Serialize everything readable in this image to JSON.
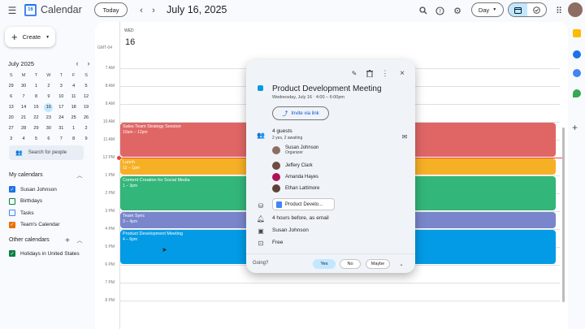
{
  "header": {
    "app_title": "Calendar",
    "logo_day": "16",
    "today_label": "Today",
    "date_title": "July 16, 2025",
    "view_label": "Day"
  },
  "sidebar": {
    "create_label": "Create",
    "mini_cal": {
      "title": "July 2025",
      "weekdays": [
        "S",
        "M",
        "T",
        "W",
        "T",
        "F",
        "S"
      ],
      "weeks": [
        [
          "29",
          "30",
          "1",
          "2",
          "3",
          "4",
          "5"
        ],
        [
          "6",
          "7",
          "8",
          "9",
          "10",
          "11",
          "12"
        ],
        [
          "13",
          "14",
          "15",
          "16",
          "17",
          "18",
          "19"
        ],
        [
          "20",
          "21",
          "22",
          "23",
          "24",
          "25",
          "26"
        ],
        [
          "27",
          "28",
          "29",
          "30",
          "31",
          "1",
          "2"
        ],
        [
          "3",
          "4",
          "5",
          "6",
          "7",
          "8",
          "9"
        ]
      ]
    },
    "search_people_placeholder": "Search for people",
    "my_calendars_label": "My calendars",
    "my_calendars": [
      {
        "label": "Susan Johnson",
        "color": "#1a73e8",
        "checked": true
      },
      {
        "label": "Birthdays",
        "color": "#0b8043",
        "checked": false
      },
      {
        "label": "Tasks",
        "color": "#4285f4",
        "checked": false
      },
      {
        "label": "Team's Calendar",
        "color": "#e8710a",
        "checked": true
      }
    ],
    "other_calendars_label": "Other calendars",
    "other_calendars": [
      {
        "label": "Holidays in United States",
        "color": "#0b8043",
        "checked": true
      }
    ]
  },
  "day_column": {
    "weekday": "WED",
    "day": "16",
    "timezone": "GMT-04"
  },
  "hours": [
    "7 AM",
    "8 AM",
    "9 AM",
    "10 AM",
    "11 AM",
    "12 PM",
    "1 PM",
    "2 PM",
    "3 PM",
    "4 PM",
    "5 PM",
    "6 PM",
    "7 PM",
    "8 PM"
  ],
  "events": [
    {
      "title": "Sales Team Strategy Session",
      "time": "10am – 12pm",
      "color": "#e06666"
    },
    {
      "title": "Lunch",
      "time": "12 – 1pm",
      "color": "#f6b026"
    },
    {
      "title": "Content Creation for Social Media",
      "time": "1 – 3pm",
      "color": "#33b679"
    },
    {
      "title": "Team Sync",
      "time": "3 – 4pm",
      "color": "#7986cb"
    },
    {
      "title": "Product Development Meeting",
      "time": "4 – 6pm",
      "color": "#039be5"
    }
  ],
  "popup": {
    "title": "Product Development Meeting",
    "subtitle": "Wednesday, July 16 ⋅ 4:00 – 6:00pm",
    "color": "#039be5",
    "invite_label": "Invite via link",
    "guests_count": "4 guests",
    "guests_status": "2 yes, 2 awaiting",
    "guests": [
      {
        "name": "Susan Johnson",
        "role": "Organizer",
        "color": "#8d6e63"
      },
      {
        "name": "Jeffery Clark",
        "role": "",
        "color": "#6d4c41"
      },
      {
        "name": "Amanda Hayes",
        "role": "",
        "color": "#ad1457"
      },
      {
        "name": "Ethan Lattimore",
        "role": "",
        "color": "#5d4037"
      }
    ],
    "attachment": "Product Develo...",
    "reminder": "4 hours before, as email",
    "calendar_owner": "Susan Johnson",
    "availability": "Free",
    "going_label": "Going?",
    "yes_label": "Yes",
    "no_label": "No",
    "maybe_label": "Maybe"
  }
}
